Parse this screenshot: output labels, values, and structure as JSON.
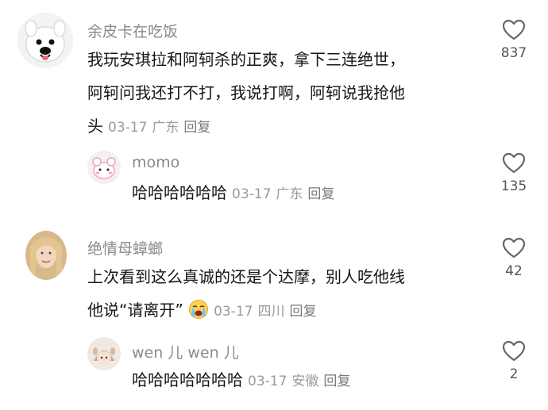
{
  "comments": [
    {
      "username": "余皮卡在吃饭",
      "text_lines": [
        "我玩安琪拉和阿轲杀的正爽，拿下三连绝世，",
        "阿轲问我还打不打，我说打啊，阿轲说我抢他",
        "头"
      ],
      "date": "03-17",
      "location": "广东",
      "reply_label": "回复",
      "likes": "837",
      "avatar_icon": "samoyed-dog-avatar"
    },
    {
      "username": "momo",
      "text_lines": [
        "哈哈哈哈哈哈"
      ],
      "date": "03-17",
      "location": "广东",
      "reply_label": "回复",
      "likes": "135",
      "avatar_icon": "pink-cartoon-avatar"
    },
    {
      "username": "绝情母蟑螂",
      "text_lines": [
        "上次看到这么真诚的还是个达摩，别人吃他线",
        "他说“请离开”"
      ],
      "emoji": "crying-face-emoji",
      "date": "03-17",
      "location": "四川",
      "reply_label": "回复",
      "likes": "42",
      "avatar_icon": "blonde-woman-avatar"
    },
    {
      "username": "wen 儿 wen 儿",
      "text_lines": [
        "哈哈哈哈哈哈哈"
      ],
      "date": "03-17",
      "location": "安徽",
      "reply_label": "回复",
      "likes": "2",
      "avatar_icon": "cartoon-avatar"
    }
  ]
}
